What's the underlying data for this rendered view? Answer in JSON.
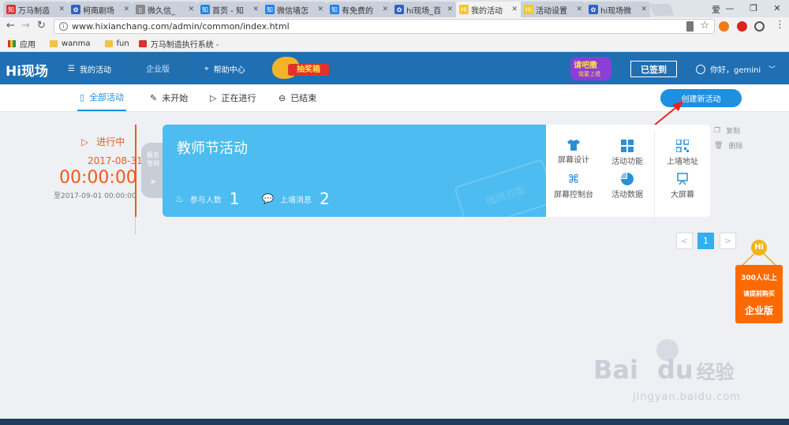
{
  "browser": {
    "tabs": [
      {
        "title": "万马制造",
        "color": "#d9322d",
        "icon": "zhi"
      },
      {
        "title": "柯南剧场",
        "color": "#2f63c6",
        "icon": "paw"
      },
      {
        "title": "微久信_",
        "color": "#888888",
        "icon": "doc"
      },
      {
        "title": "首页 - 知",
        "color": "#1e82e6",
        "icon": "zhi"
      },
      {
        "title": "微信墙怎",
        "color": "#1e82e6",
        "icon": "zhi"
      },
      {
        "title": "有免费的",
        "color": "#1e82e6",
        "icon": "zhi"
      },
      {
        "title": "hi现场_百",
        "color": "#2f63c6",
        "icon": "paw"
      },
      {
        "title": "我的活动",
        "color": "#f2c530",
        "icon": "hi",
        "active": true
      },
      {
        "title": "活动设置",
        "color": "#f2c530",
        "icon": "hi"
      },
      {
        "title": "hi现场微",
        "color": "#2f63c6",
        "icon": "paw"
      }
    ],
    "profile_name": "爱",
    "url": "www.hixianchang.com/admin/common/index.html",
    "bookmarks": [
      {
        "label": "应用",
        "icon": "apps-icon"
      },
      {
        "label": "wanma",
        "icon": "folder-icon"
      },
      {
        "label": "fun",
        "icon": "folder-icon"
      },
      {
        "label": "万马制造执行系统 -",
        "icon": "zhi-icon"
      }
    ]
  },
  "nav": {
    "logo": "Hi现场",
    "my_activity": "我的活动",
    "enterprise": "企业版",
    "help": "帮助中心",
    "lottery_badge": "抽奖箱",
    "promo_badge_top": "请吧撒",
    "promo_badge_bottom": "我要上墙",
    "signed_button": "已签到",
    "greeting": "你好，gemini"
  },
  "filters": [
    {
      "label": "全部活动",
      "icon": "doc-icon",
      "active": true
    },
    {
      "label": "未开始",
      "icon": "pen-icon"
    },
    {
      "label": "正在进行",
      "icon": "play-icon"
    },
    {
      "label": "已结束",
      "icon": "minus-circle-icon"
    }
  ],
  "create_button": "创建新活动",
  "activity": {
    "status": "进行中",
    "start_date": "2017-08-31",
    "time": "00:00:00",
    "end": "至2017-09-01 00:00:00",
    "side_tag_1": "报名",
    "side_tag_2": "签到",
    "title": "教师节活动",
    "participants_label": "参与人数",
    "participants_value": "1",
    "messages_label": "上墙消息",
    "messages_value": "2",
    "watermark": "微网页版",
    "functions": [
      {
        "label": "屏幕设计",
        "icon": "shirt-icon"
      },
      {
        "label": "活动功能",
        "icon": "grid-icon"
      },
      {
        "label": "上墙地址",
        "icon": "qrcode-icon"
      },
      {
        "label": "屏幕控制台",
        "icon": "command-icon"
      },
      {
        "label": "活动数据",
        "icon": "pie-icon"
      },
      {
        "label": "大屏幕",
        "icon": "screen-icon"
      }
    ],
    "copy": "复制",
    "delete": "删除"
  },
  "pagination": {
    "prev": "<",
    "current": "1",
    "next": ">"
  },
  "promo": {
    "hi": "Hi",
    "line1": "300人以上",
    "line2": "请提前购买",
    "line3": "企业版"
  },
  "watermark": {
    "brand": "Bai",
    "brand2": "du",
    "cn": "经验",
    "url": "jingyan.baidu.com"
  },
  "colors": {
    "primary": "#1f6fb2",
    "card_blue": "#4dbcf0",
    "accent_orange": "#ff6a00",
    "status_orange": "#f05a1e"
  }
}
